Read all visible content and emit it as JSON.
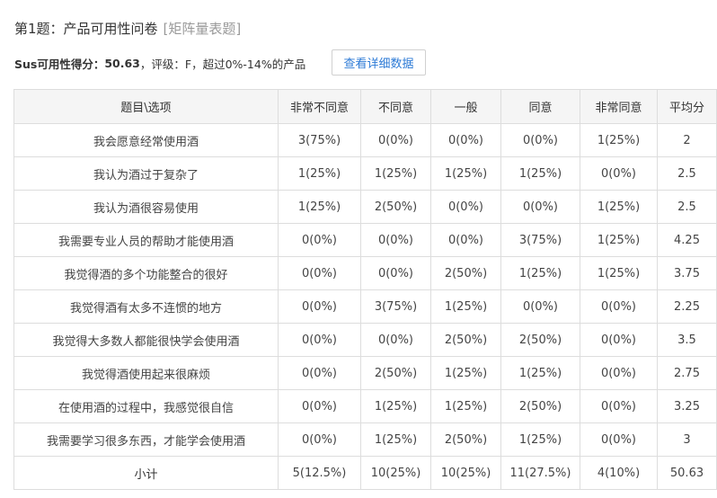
{
  "question": {
    "title": "第1题：产品可用性问卷",
    "type_tag": "[矩阵量表题]"
  },
  "summary": {
    "sus_label": "Sus可用性得分：",
    "sus_score": "50.63",
    "rest": "，评级：F，超过0%-14%的产品",
    "detail_button": "查看详细数据"
  },
  "table": {
    "headers": [
      "题目\\选项",
      "非常不同意",
      "不同意",
      "一般",
      "同意",
      "非常同意",
      "平均分"
    ],
    "rows": [
      [
        "我会愿意经常使用酒",
        "3(75%)",
        "0(0%)",
        "0(0%)",
        "0(0%)",
        "1(25%)",
        "2"
      ],
      [
        "我认为酒过于复杂了",
        "1(25%)",
        "1(25%)",
        "1(25%)",
        "1(25%)",
        "0(0%)",
        "2.5"
      ],
      [
        "我认为酒很容易使用",
        "1(25%)",
        "2(50%)",
        "0(0%)",
        "0(0%)",
        "1(25%)",
        "2.5"
      ],
      [
        "我需要专业人员的帮助才能使用酒",
        "0(0%)",
        "0(0%)",
        "0(0%)",
        "3(75%)",
        "1(25%)",
        "4.25"
      ],
      [
        "我觉得酒的多个功能整合的很好",
        "0(0%)",
        "0(0%)",
        "2(50%)",
        "1(25%)",
        "1(25%)",
        "3.75"
      ],
      [
        "我觉得酒有太多不连惯的地方",
        "0(0%)",
        "3(75%)",
        "1(25%)",
        "0(0%)",
        "0(0%)",
        "2.25"
      ],
      [
        "我觉得大多数人都能很快学会使用酒",
        "0(0%)",
        "0(0%)",
        "2(50%)",
        "2(50%)",
        "0(0%)",
        "3.5"
      ],
      [
        "我觉得酒使用起来很麻烦",
        "0(0%)",
        "2(50%)",
        "1(25%)",
        "1(25%)",
        "0(0%)",
        "2.75"
      ],
      [
        "在使用酒的过程中，我感觉很自信",
        "0(0%)",
        "1(25%)",
        "1(25%)",
        "2(50%)",
        "0(0%)",
        "3.25"
      ],
      [
        "我需要学习很多东西，才能学会使用酒",
        "0(0%)",
        "1(25%)",
        "2(50%)",
        "1(25%)",
        "0(0%)",
        "3"
      ]
    ],
    "total": [
      "小计",
      "5(12.5%)",
      "10(25%)",
      "10(25%)",
      "11(27.5%)",
      "4(10%)",
      "50.63"
    ]
  }
}
